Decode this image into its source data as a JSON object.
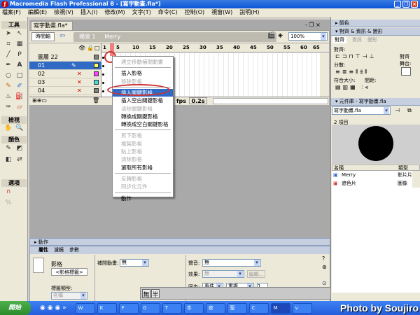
{
  "window": {
    "title": "Macromedia Flash Professional 8 - [寫字動畫.fla*]",
    "min": "_",
    "max": "❐",
    "close": "×"
  },
  "menu": [
    "檔案(F)",
    "編輯(E)",
    "檢視(V)",
    "插入(I)",
    "修改(M)",
    "文字(T)",
    "命令(C)",
    "控制(O)",
    "視窗(W)",
    "說明(H)"
  ],
  "tools": {
    "title": "工具",
    "view": "檢視",
    "colors": "顏色",
    "options": "選項"
  },
  "document": {
    "tab": "寫字動畫.fla*",
    "timeline_button": "時間軸",
    "scene": "場景 1",
    "symbol": "Merry",
    "zoom": "100%"
  },
  "timeline": {
    "ruler": [
      "1",
      "5",
      "10",
      "15",
      "20",
      "25",
      "30",
      "35",
      "40",
      "45",
      "50",
      "55",
      "60",
      "65"
    ],
    "layers": [
      {
        "name": "圖層 22",
        "color": "#808080"
      },
      {
        "name": "01",
        "color": "#ffff66"
      },
      {
        "name": "02",
        "color": "#ff44ff"
      },
      {
        "name": "03",
        "color": "#44dddd"
      },
      {
        "name": "04",
        "color": "#808080"
      }
    ],
    "fps_label": "fps",
    "time": "0.2s"
  },
  "context_menu": {
    "items": [
      {
        "label": "建立移動補間動畫",
        "disabled": true
      },
      {
        "sep": true
      },
      {
        "label": "插入影格"
      },
      {
        "label": "移除影格",
        "disabled": true
      },
      {
        "sep": true
      },
      {
        "label": "插入關鍵影格",
        "highlight": true
      },
      {
        "label": "插入空白關鍵影格"
      },
      {
        "label": "清除關鍵影格",
        "disabled": true
      },
      {
        "label": "轉換成關鍵影格"
      },
      {
        "label": "轉換成空白關鍵影格"
      },
      {
        "sep": true
      },
      {
        "label": "剪下影格",
        "disabled": true
      },
      {
        "label": "複製影格",
        "disabled": true
      },
      {
        "label": "貼上影格",
        "disabled": true
      },
      {
        "label": "清除影格",
        "disabled": true
      },
      {
        "label": "選取所有影格"
      },
      {
        "sep": true
      },
      {
        "label": "反轉影格",
        "disabled": true
      },
      {
        "label": "同步化元件",
        "disabled": true
      },
      {
        "sep": true
      },
      {
        "label": "動作"
      }
    ]
  },
  "actions_panel": "動作",
  "properties": {
    "tabs": [
      "屬性",
      "濾鏡",
      "參數"
    ],
    "frame_label": "影格",
    "frame_name_placeholder": "<影格標籤>",
    "tween_label": "補間動畫:",
    "tween_value": "無",
    "sound_label": "聲音:",
    "sound_value": "無",
    "effect_label": "效果:",
    "effect_value": "無",
    "edit_button": "編輯...",
    "sync_label": "同步:",
    "sync_value": "事件",
    "repeat_value": "重複",
    "repeat_count": "1",
    "label_type_label": "標籤類型:",
    "label_type_value": "名稱"
  },
  "ime": {
    "a": "無",
    "b": "半"
  },
  "right_panel": {
    "color_header": "顏色",
    "align_header": "對齊 & 資訊 & 變形",
    "align_tabs": [
      "對齊",
      "資訊",
      "變形"
    ],
    "align_label": "對齊:",
    "distribute_label": "分散:",
    "match_size_label": "符合大小:",
    "spacing_label": "間距:",
    "to_stage_label": "對齊\n舞台:",
    "library_header": "元件庫 - 寫字動畫.fla",
    "library_file": "寫字動畫.fla",
    "item_count": "2 項目",
    "columns": [
      "名稱",
      "類型"
    ],
    "items": [
      {
        "name": "Merry",
        "type": "影片片段"
      },
      {
        "name": "遮色片",
        "type": "圖像"
      }
    ]
  },
  "taskbar": {
    "start": "開始",
    "buttons": [
      "W",
      "K",
      "F",
      "0",
      "T",
      "本",
      "夜",
      "聖",
      "C",
      "M",
      "v"
    ]
  },
  "watermark": "Photo by Soujiro"
}
